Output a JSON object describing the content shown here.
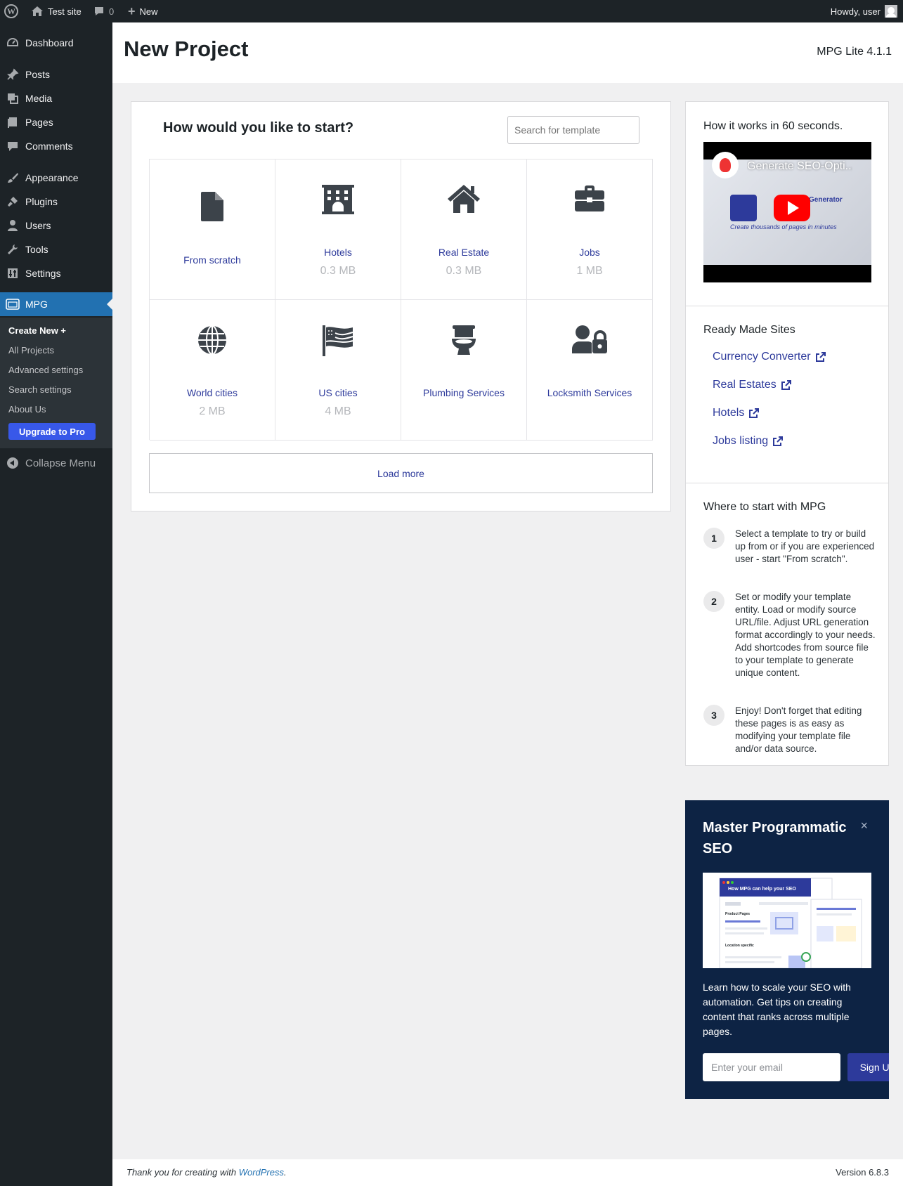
{
  "adminbar": {
    "site_name": "Test site",
    "comments_count": "0",
    "new_label": "New",
    "howdy": "Howdy, user"
  },
  "sidebar": {
    "items": [
      {
        "label": "Dashboard",
        "icon": "dashboard-icon"
      },
      {
        "label": "Posts",
        "icon": "pin-icon"
      },
      {
        "label": "Media",
        "icon": "media-icon"
      },
      {
        "label": "Pages",
        "icon": "pages-icon"
      },
      {
        "label": "Comments",
        "icon": "comment-icon"
      },
      {
        "label": "Appearance",
        "icon": "brush-icon"
      },
      {
        "label": "Plugins",
        "icon": "plug-icon"
      },
      {
        "label": "Users",
        "icon": "user-icon"
      },
      {
        "label": "Tools",
        "icon": "wrench-icon"
      },
      {
        "label": "Settings",
        "icon": "sliders-icon"
      },
      {
        "label": "MPG",
        "icon": "mpg-icon"
      }
    ],
    "submenu": [
      "Create New +",
      "All Projects",
      "Advanced settings",
      "Search settings",
      "About Us"
    ],
    "upgrade_label": "Upgrade to Pro",
    "collapse_label": "Collapse Menu"
  },
  "header": {
    "title": "New Project",
    "version": "MPG Lite 4.1.1"
  },
  "main": {
    "heading": "How would you like to start?",
    "search_placeholder": "Search for template",
    "tiles": [
      {
        "name": "From scratch",
        "size": "",
        "icon": "file-icon"
      },
      {
        "name": "Hotels",
        "size": "0.3 MB",
        "icon": "hotel-icon"
      },
      {
        "name": "Real Estate",
        "size": "0.3 MB",
        "icon": "house-icon"
      },
      {
        "name": "Jobs",
        "size": "1 MB",
        "icon": "briefcase-icon"
      },
      {
        "name": "World cities",
        "size": "2 MB",
        "icon": "globe-icon"
      },
      {
        "name": "US cities",
        "size": "4 MB",
        "icon": "flag-icon"
      },
      {
        "name": "Plumbing Services",
        "size": "",
        "icon": "toilet-icon"
      },
      {
        "name": "Locksmith Services",
        "size": "",
        "icon": "user-lock-icon"
      }
    ],
    "load_more": "Load more"
  },
  "side": {
    "video_heading": "How it works in 60 seconds.",
    "video_title": "Generate SEO-Opti...",
    "video_gen": "Generator",
    "video_sub": "Create thousands of pages in minutes",
    "ready_heading": "Ready Made Sites",
    "sites": [
      "Currency Converter",
      "Real Estates",
      "Hotels",
      "Jobs listing"
    ],
    "start_heading": "Where to start with MPG",
    "steps": [
      {
        "num": "1",
        "text": "Select a template to try or build up from or if you are experienced user - start \"From scratch\"."
      },
      {
        "num": "2",
        "text": "Set or modify your template entity. Load or modify source URL/file. Adjust URL generation format accordingly to your needs. Add shortcodes from source file to your template to generate unique content."
      },
      {
        "num": "3",
        "text": "Enjoy! Don't forget that editing these pages is as easy as modifying your template file and/or data source."
      }
    ]
  },
  "promo": {
    "title": "Master Programmatic SEO",
    "close": "×",
    "image_heading": "How MPG can help your SEO",
    "image_label_1": "Product Pages",
    "image_label_2": "Location specific",
    "text": "Learn how to scale your SEO with automation. Get tips on creating content that ranks across multiple pages.",
    "email_placeholder": "Enter your email",
    "signup": "Sign Up"
  },
  "footer": {
    "thanks_prefix": "Thank you for creating with ",
    "thanks_link": "WordPress",
    "thanks_suffix": ".",
    "version": "Version 6.8.3"
  }
}
